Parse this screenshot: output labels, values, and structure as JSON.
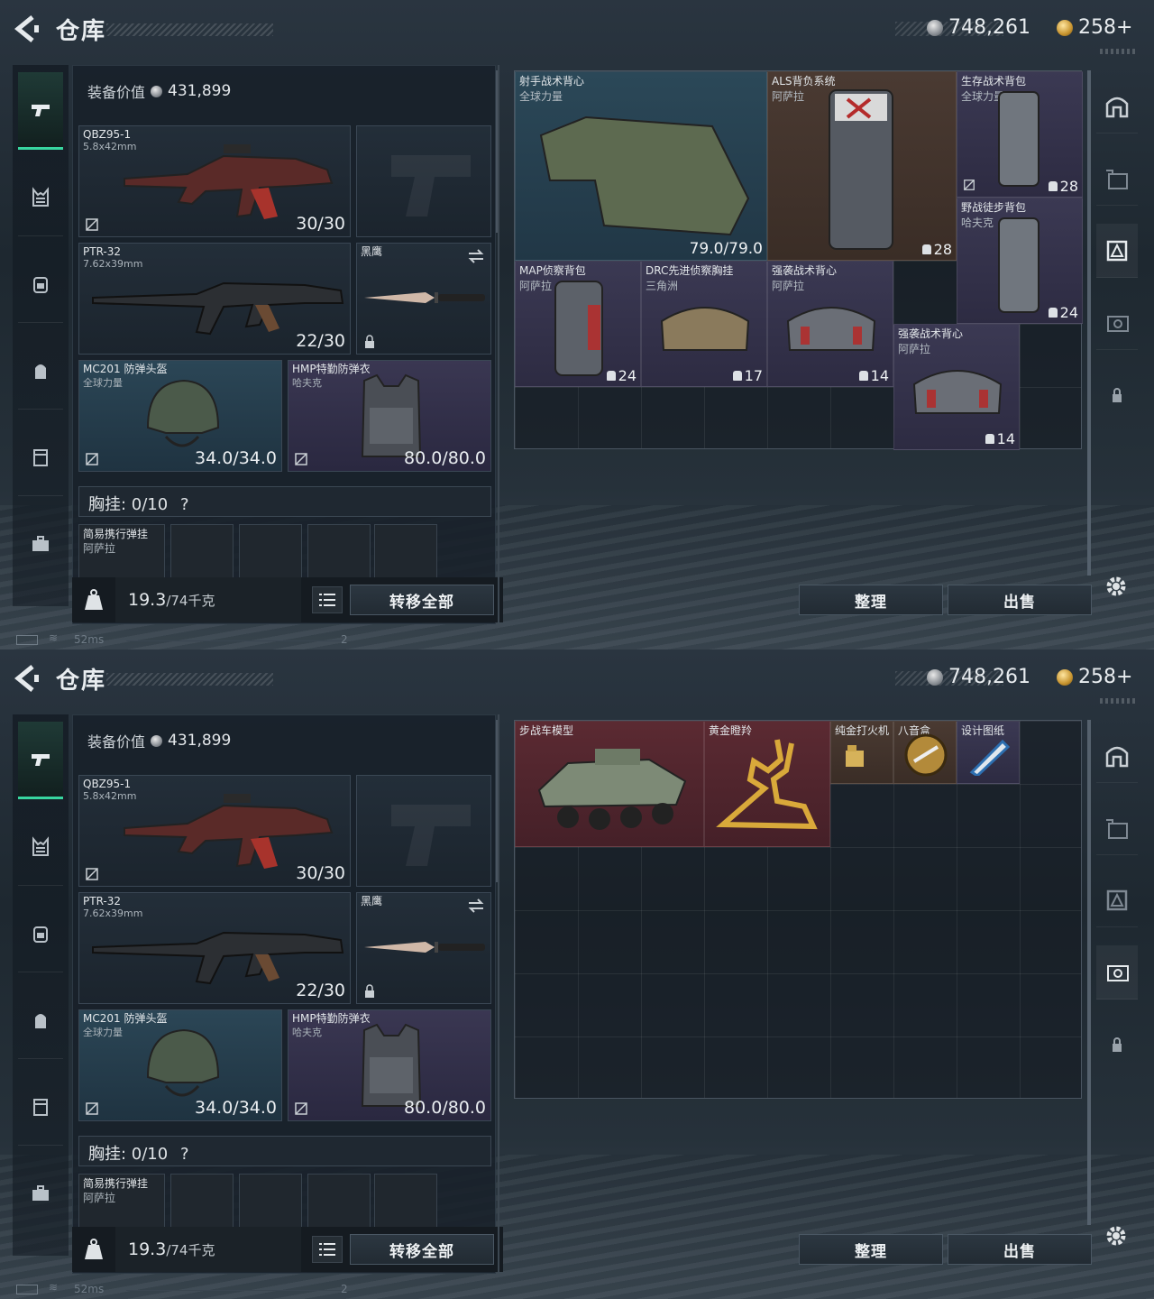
{
  "title": "仓库",
  "currency": {
    "silver": "748,261",
    "gold": "258+"
  },
  "equip_value": {
    "label": "装备价值",
    "value": "431,899"
  },
  "slots": {
    "primary": {
      "name": "QBZ95-1",
      "sub": "5.8x42mm",
      "dur": "30/30"
    },
    "secondary": {
      "name": "PTR-32",
      "sub": "7.62x39mm",
      "dur": "22/30"
    },
    "melee": {
      "name": "黑鹰"
    },
    "helmet": {
      "name": "MC201 防弹头盔",
      "sub": "全球力量",
      "dur": "34.0/34.0"
    },
    "armor": {
      "name": "HMP特勤防弹衣",
      "sub": "哈夫克",
      "dur": "80.0/80.0"
    }
  },
  "chest": {
    "label": "胸挂: 0/10",
    "help": "?"
  },
  "chest_item": {
    "name": "简易携行弹挂",
    "sub": "阿萨拉"
  },
  "weight": {
    "value": "19.3",
    "max": "/74千克"
  },
  "buttons": {
    "transfer_all": "转移全部",
    "sort": "整理",
    "sell": "出售"
  },
  "stash1": [
    {
      "name": "射手战术背心",
      "sub": "全球力量",
      "val": "79.0/79.0",
      "rarity": "blue"
    },
    {
      "name": "ALS背负系统",
      "sub": "阿萨拉",
      "val": "28",
      "rarity": "brown"
    },
    {
      "name": "生存战术背包",
      "sub": "全球力量",
      "val": "28",
      "rarity": "purple"
    },
    {
      "name": "野战徒步背包",
      "sub": "哈夫克",
      "val": "24",
      "rarity": "purple"
    },
    {
      "name": "MAP侦察背包",
      "sub": "阿萨拉",
      "val": "24",
      "rarity": "purple"
    },
    {
      "name": "DRC先进侦察胸挂",
      "sub": "三角洲",
      "val": "17",
      "rarity": "purple"
    },
    {
      "name": "强袭战术背心",
      "sub": "阿萨拉",
      "val": "14",
      "rarity": "purple"
    },
    {
      "name": "强袭战术背心",
      "sub": "阿萨拉",
      "val": "14",
      "rarity": "purple"
    }
  ],
  "stash2": [
    {
      "name": "步战车模型",
      "rarity": "red"
    },
    {
      "name": "黄金瞪羚",
      "rarity": "red"
    },
    {
      "name": "纯金打火机",
      "rarity": "brown"
    },
    {
      "name": "八音盒",
      "rarity": "brown"
    },
    {
      "name": "设计图纸",
      "rarity": "purple"
    }
  ],
  "status": {
    "ping": "52ms",
    "num": "2"
  },
  "colors": {
    "accent": "#38d6a0",
    "blue": "#2b4858",
    "purple": "#3b3953",
    "red": "#5b2a32",
    "brown": "#4a3a32"
  }
}
